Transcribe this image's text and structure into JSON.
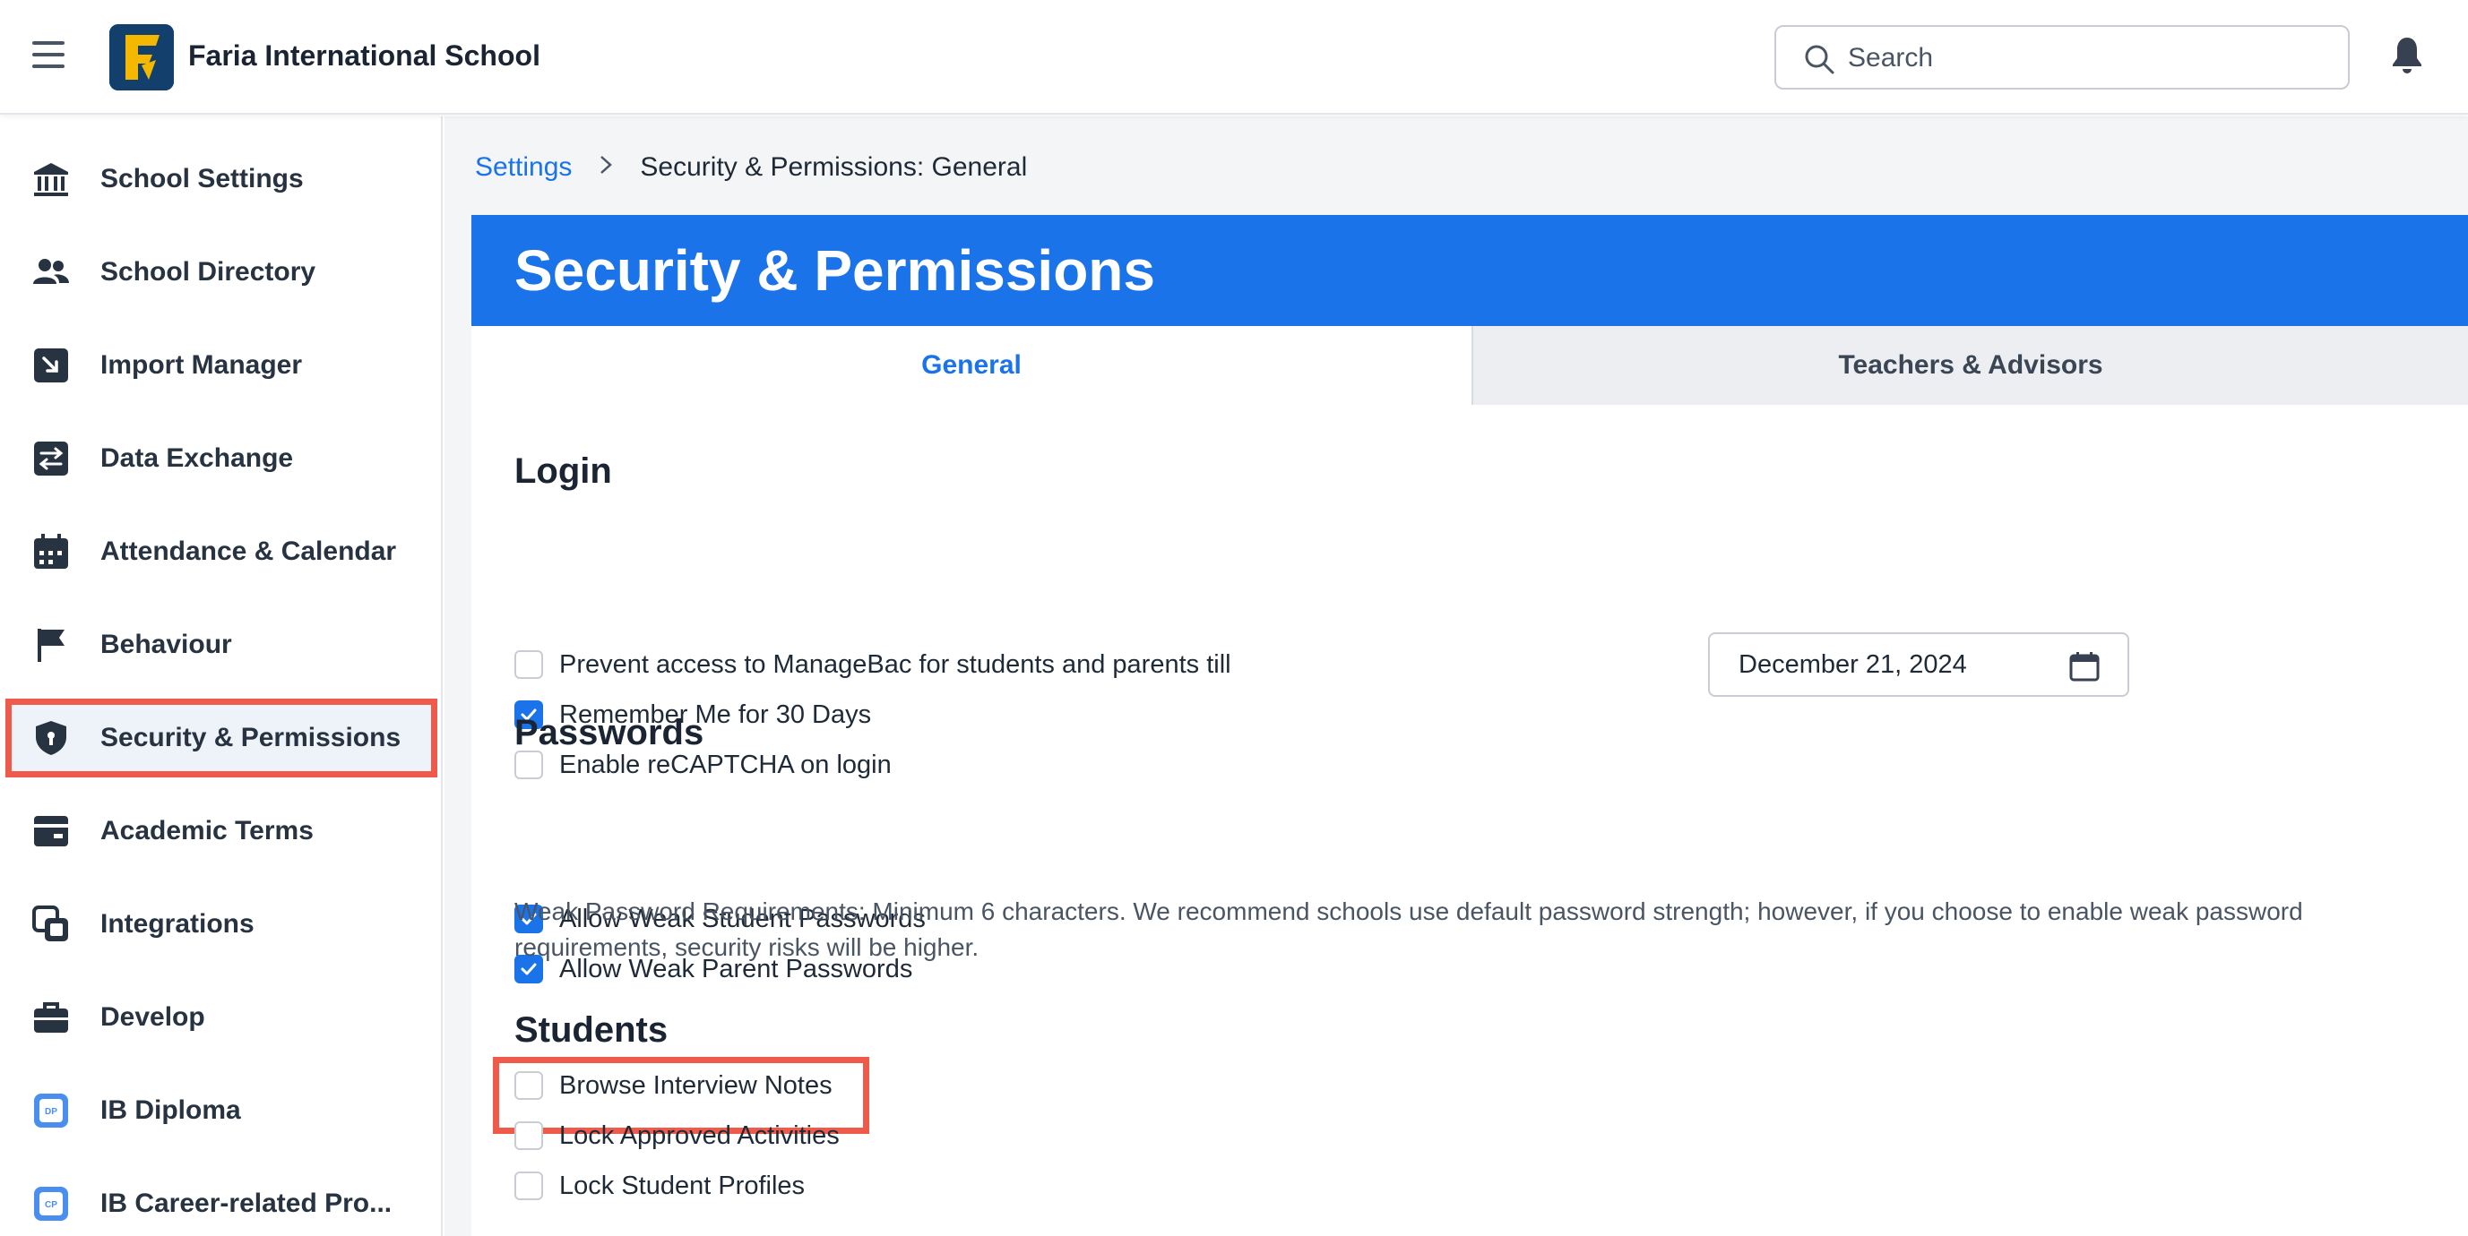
{
  "app": {
    "school_name": "Faria International School",
    "search_placeholder": "Search"
  },
  "sidebar": {
    "items": [
      {
        "label": "School Settings",
        "icon": "bank-icon"
      },
      {
        "label": "School Directory",
        "icon": "people-icon"
      },
      {
        "label": "Import Manager",
        "icon": "import-icon"
      },
      {
        "label": "Data Exchange",
        "icon": "exchange-icon"
      },
      {
        "label": "Attendance & Calendar",
        "icon": "calendar-icon"
      },
      {
        "label": "Behaviour",
        "icon": "flag-icon"
      },
      {
        "label": "Security & Permissions",
        "icon": "shield-icon",
        "active": true
      },
      {
        "label": "Academic Terms",
        "icon": "terms-icon"
      },
      {
        "label": "Integrations",
        "icon": "integrations-icon"
      },
      {
        "label": "Develop",
        "icon": "briefcase-icon"
      },
      {
        "label": "IB Diploma",
        "icon": "dp-icon",
        "badge": "DP"
      },
      {
        "label": "IB Career-related Pro...",
        "icon": "cp-icon",
        "badge": "CP"
      }
    ]
  },
  "breadcrumb": {
    "parent": "Settings",
    "current": "Security & Permissions: General"
  },
  "panel": {
    "title": "Security & Permissions",
    "tabs": [
      {
        "label": "General",
        "active": true
      },
      {
        "label": "Teachers & Advisors",
        "active": false
      }
    ]
  },
  "login": {
    "title": "Login",
    "prevent_access": {
      "label": "Prevent access to ManageBac for students and parents till",
      "checked": false
    },
    "date_value": "December 21, 2024",
    "remember_me": {
      "label": "Remember Me for 30 Days",
      "checked": true
    },
    "recaptcha": {
      "label": "Enable reCAPTCHA on login",
      "checked": false
    }
  },
  "passwords": {
    "title": "Passwords",
    "weak_student": {
      "label": "Allow Weak Student Passwords",
      "checked": true
    },
    "weak_parent": {
      "label": "Allow Weak Parent Passwords",
      "checked": true
    },
    "note": "Weak Password Requirements: Minimum 6 characters. We recommend schools use default password strength; however, if you choose to enable weak password requirements, security risks will be higher."
  },
  "students": {
    "title": "Students",
    "browse_notes": {
      "label": "Browse Interview Notes",
      "checked": false
    },
    "lock_activities": {
      "label": "Lock Approved Activities",
      "checked": false
    },
    "lock_profiles": {
      "label": "Lock Student Profiles",
      "checked": false
    }
  },
  "colors": {
    "accent": "#1a73e8",
    "highlight": "#ef5a4a",
    "logo_bg": "#123f6b",
    "logo_fg": "#f5b800"
  }
}
